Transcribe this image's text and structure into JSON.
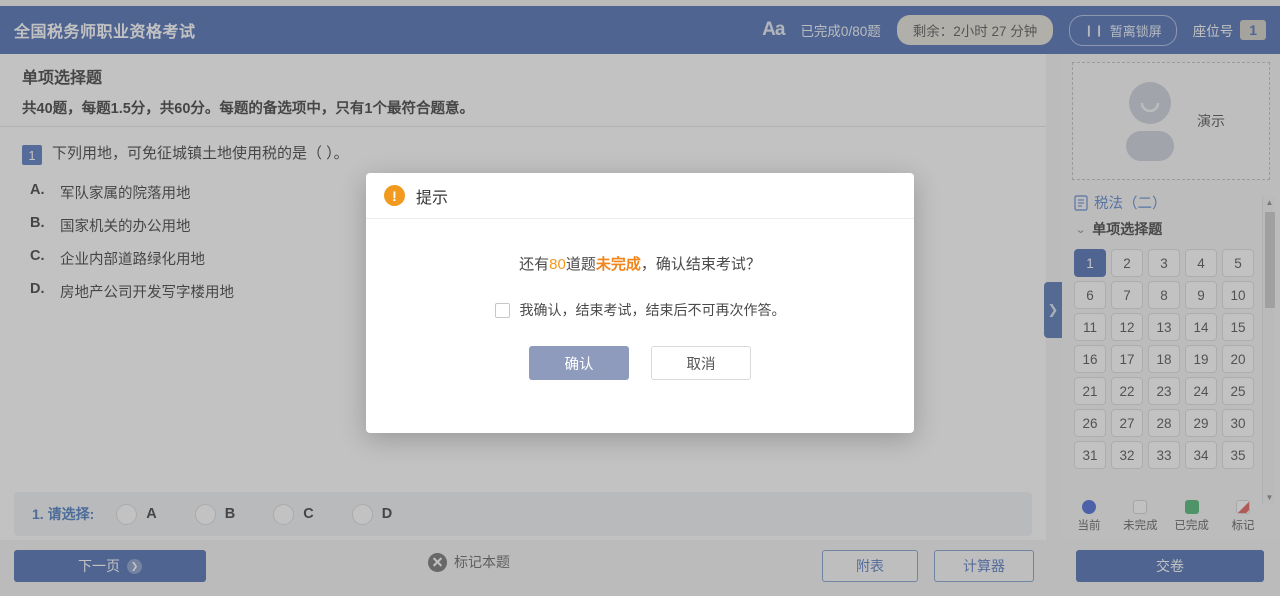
{
  "header": {
    "exam_title": "全国税务师职业资格考试",
    "font_size_icon": "Aa",
    "progress": "已完成0/80题",
    "timer": "剩余：2小时 27 分钟",
    "lock_button": "暂离锁屏",
    "seat_label": "座位号",
    "seat_number": "1",
    "bg_color": "#2f55a4"
  },
  "content": {
    "section_title": "单项选择题",
    "section_desc": "共40题，每题1.5分，共60分。每题的备选项中，只有1个最符合题意。",
    "question_index": "1",
    "question_stem": "下列用地，可免征城镇土地使用税的是（          ）。",
    "options": [
      {
        "letter": "A.",
        "text": "军队家属的院落用地"
      },
      {
        "letter": "B.",
        "text": "国家机关的办公用地"
      },
      {
        "letter": "C.",
        "text": "企业内部道路绿化用地"
      },
      {
        "letter": "D.",
        "text": "房地产公司开发写字楼用地"
      }
    ]
  },
  "answer_bar": {
    "label": "1. 请选择:",
    "choices": [
      "A",
      "B",
      "C",
      "D"
    ],
    "selected": null,
    "label_color": "#2b63b5"
  },
  "collapse_handle": {
    "glyph": "❯"
  },
  "sidebar": {
    "candidate_name": "演示",
    "subject": "税法（二）",
    "group": "单项选择题",
    "chevron": "⌄",
    "question_numbers": [
      "1",
      "2",
      "3",
      "4",
      "5",
      "6",
      "7",
      "8",
      "9",
      "10",
      "11",
      "12",
      "13",
      "14",
      "15",
      "16",
      "17",
      "18",
      "19",
      "20",
      "21",
      "22",
      "23",
      "24",
      "25",
      "26",
      "27",
      "28",
      "29",
      "30",
      "31",
      "32",
      "33",
      "34",
      "35"
    ],
    "current_question": "1",
    "legend": [
      {
        "label": "当前",
        "color": "#2a4fd0"
      },
      {
        "label": "未完成",
        "color": "#ffffff"
      },
      {
        "label": "已完成",
        "color": "#2cab5b"
      },
      {
        "label": "标记",
        "color": "#e14343"
      }
    ]
  },
  "toolbar": {
    "next_page": "下一页",
    "next_arrow": "❯",
    "flag_question": "标记本题",
    "attachment": "附表",
    "calculator": "计算器",
    "submit": "交卷"
  },
  "modal": {
    "icon": "!",
    "title": "提示",
    "message_prefix": "还有",
    "message_count": "80",
    "message_mid": "道题",
    "message_status": "未完成",
    "message_suffix": "，确认结束考试？",
    "checkbox_label": "我确认，结束考试，结束后不可再次作答。",
    "checkbox_checked": false,
    "confirm": "确认",
    "cancel": "取消",
    "accent_color": "#f2991f"
  }
}
